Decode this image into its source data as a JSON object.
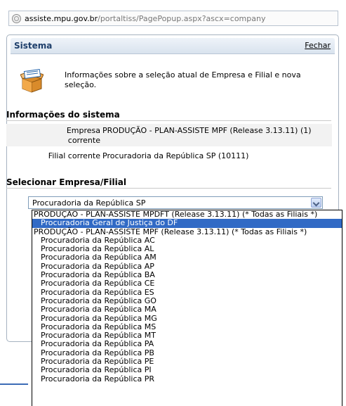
{
  "address_bar": {
    "host": "assiste.mpu.gov.br",
    "path": "/portaltiss/PagePopup.aspx?ascx=company",
    "icon": "page-icon"
  },
  "dialog": {
    "title": "Sistema",
    "close_label": "Fechar",
    "info_icon": "box-icon",
    "info_text": "Informações sobre a seleção atual de Empresa e Filial e  nova seleção.",
    "system_section": {
      "title": "Informações do sistema",
      "empresa_label": "Empresa corrente",
      "empresa_value": "PRODUÇÃO - PLAN-ASSISTE MPF (Release 3.13.11) (1)",
      "filial_label": "Filial corrente",
      "filial_value": "Procuradoria da República SP (10111)"
    },
    "select_section": {
      "title": "Selecionar Empresa/Filial",
      "selected_value": "Procuradoria da República SP"
    }
  },
  "dropdown": {
    "options": [
      {
        "label": "PRODUÇÃO - PLAN-ASSISTE MPDFT (Release 3.13.11) (* Todas as Filiais *)",
        "indent": false,
        "selected": false
      },
      {
        "label": "Procuradoria Geral de Justiça do DF",
        "indent": true,
        "selected": true
      },
      {
        "label": "PRODUÇÃO - PLAN-ASSISTE MPF (Release 3.13.11) (* Todas as Filiais *)",
        "indent": false,
        "selected": false
      },
      {
        "label": "Procuradoria da República AC",
        "indent": true,
        "selected": false
      },
      {
        "label": "Procuradoria da República AL",
        "indent": true,
        "selected": false
      },
      {
        "label": "Procuradoria da República AM",
        "indent": true,
        "selected": false
      },
      {
        "label": "Procuradoria da República AP",
        "indent": true,
        "selected": false
      },
      {
        "label": "Procuradoria da República BA",
        "indent": true,
        "selected": false
      },
      {
        "label": "Procuradoria da República CE",
        "indent": true,
        "selected": false
      },
      {
        "label": "Procuradoria da República ES",
        "indent": true,
        "selected": false
      },
      {
        "label": "Procuradoria da República GO",
        "indent": true,
        "selected": false
      },
      {
        "label": "Procuradoria da República MA",
        "indent": true,
        "selected": false
      },
      {
        "label": "Procuradoria da República MG",
        "indent": true,
        "selected": false
      },
      {
        "label": "Procuradoria da República MS",
        "indent": true,
        "selected": false
      },
      {
        "label": "Procuradoria da República MT",
        "indent": true,
        "selected": false
      },
      {
        "label": "Procuradoria da República PA",
        "indent": true,
        "selected": false
      },
      {
        "label": "Procuradoria da República PB",
        "indent": true,
        "selected": false
      },
      {
        "label": "Procuradoria da República PE",
        "indent": true,
        "selected": false
      },
      {
        "label": "Procuradoria da República PI",
        "indent": true,
        "selected": false
      },
      {
        "label": "Procuradoria da República PR",
        "indent": true,
        "selected": false
      }
    ]
  },
  "colors": {
    "selection": "#316ac5",
    "header_title": "#1e3f6b"
  }
}
